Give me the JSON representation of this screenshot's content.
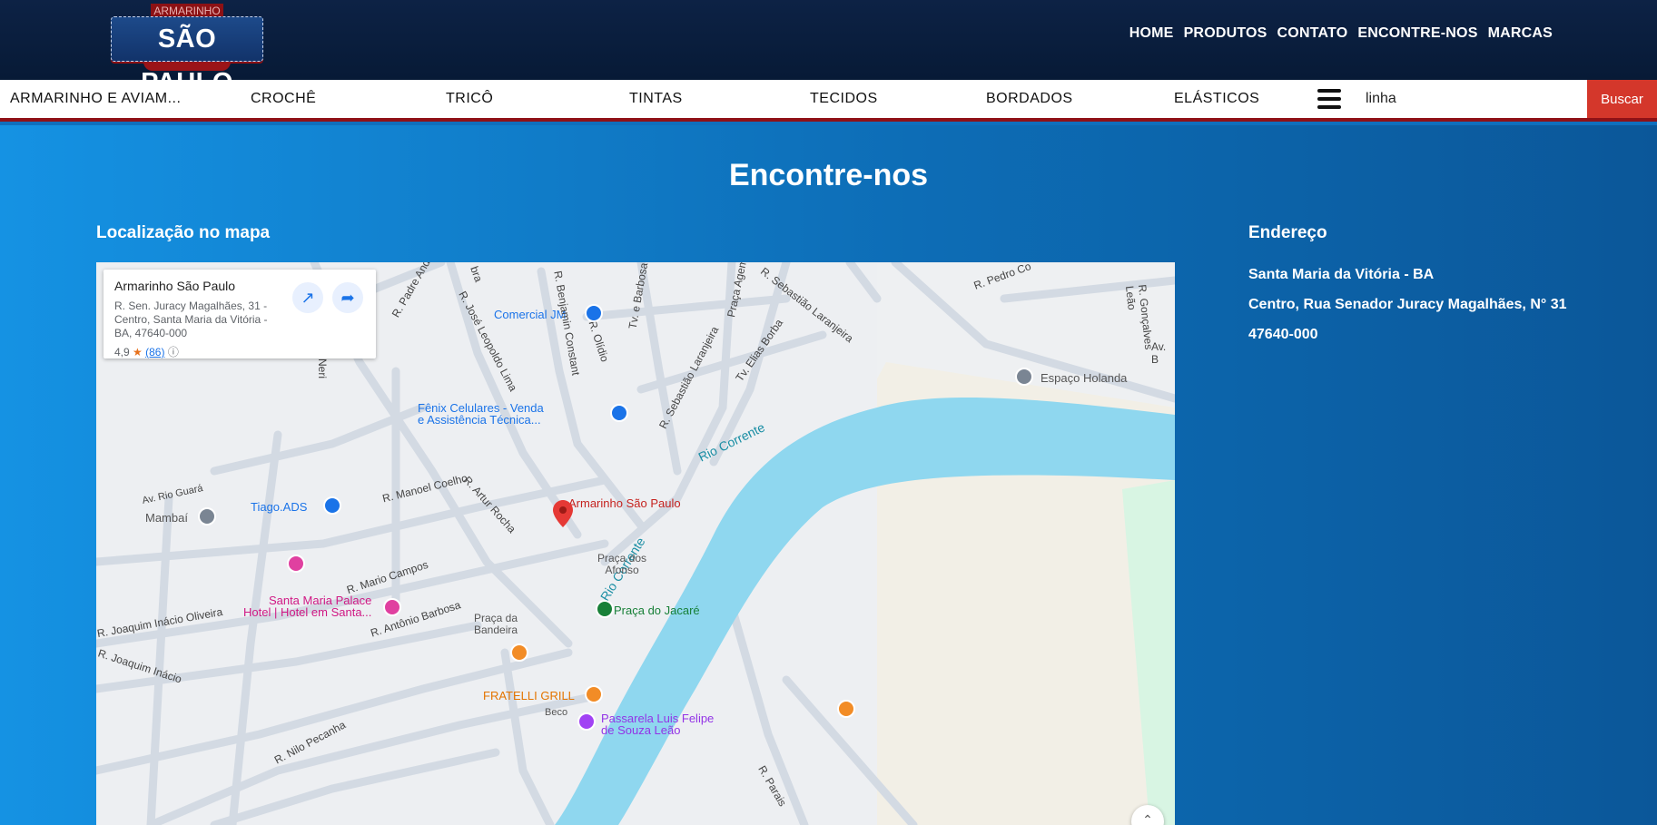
{
  "header": {
    "logo": {
      "top_text": "ARMARINHO",
      "main_text": "SÃO PAULO"
    },
    "nav": [
      {
        "label": "HOME"
      },
      {
        "label": "PRODUTOS"
      },
      {
        "label": "CONTATO"
      },
      {
        "label": "ENCONTRE-NOS"
      },
      {
        "label": "MARCAS"
      }
    ]
  },
  "categories": [
    {
      "label": "ARMARINHO E AVIAM..."
    },
    {
      "label": "CROCHÊ"
    },
    {
      "label": "TRICÔ"
    },
    {
      "label": "TINTAS"
    },
    {
      "label": "TECIDOS"
    },
    {
      "label": "BORDADOS"
    },
    {
      "label": "ELÁSTICOS"
    }
  ],
  "search": {
    "value": "linha",
    "button_label": "Buscar"
  },
  "page": {
    "title": "Encontre-nos",
    "map_section_title": "Localização no mapa",
    "address_section_title": "Endereço",
    "address_lines": [
      "Santa Maria da Vitória - BA",
      "Centro, Rua Senador Juracy Magalhães, N° 31",
      "47640-000"
    ]
  },
  "map": {
    "card": {
      "name": "Armarinho São Paulo",
      "address": "R. Sen. Juracy Magalhães, 31 - Centro, Santa Maria da Vitória - BA, 47640-000",
      "rating": "4,9",
      "star": "★",
      "reviews": "(86)",
      "info_icon": "ⓘ",
      "open_icon": "↗",
      "directions_icon": "➦"
    },
    "labels": {
      "place": "Armarinho São Paulo",
      "river1": "Rio Corrente",
      "river2": "Rio Corrente",
      "comercial": "Comercial JM",
      "fenix1": "Fênix Celulares - Venda",
      "fenix2": "e Assistência Técnica...",
      "tiago": "Tiago.ADS",
      "mambai": "Mambaí",
      "espaco": "Espaço Holanda",
      "pracaAfonso1": "Praça dos",
      "pracaAfonso2": "Afonso",
      "pracaJacare": "Praça do Jacaré",
      "pracaBandeira1": "Praça da",
      "pracaBandeira2": "Bandeira",
      "fratelli": "FRATELLI GRILL",
      "passarela1": "Passarela Luis Felipe",
      "passarela2": "de Souza Leão",
      "hotel1": "Santa Maria Palace",
      "hotel2": "Hotel | Hotel em Santa...",
      "beco": "Beco",
      "rPadre": "R. Padre Andr",
      "rJose": "R. José Leopoldo Lima",
      "rBenjamin": "R. Benjamin Constant",
      "rOlidio": "R. Olídio",
      "tvBarbosa": "Tv. e Barbosa",
      "tvElias": "Tv. Elias Borba",
      "rSebastiao1": "R. Sebastião Laranjeira",
      "rSebastiao2": "R. Sebastião Laranjeira",
      "pracaAgemi": "Praça Agemi",
      "rPedro": "R. Pedro Co",
      "rGoncalves": "R. Gonçalves Leão",
      "avFragment": "Av. B",
      "rManoel": "R. Manoel Coelho",
      "rArtur": "R. Artur Rocha",
      "rMario": "R. Mario Campos",
      "rAntonio": "R. Antônio Barbosa",
      "rJoaquim1": "R. Joaquim Inácio Oliveira",
      "rJoaquim2": "R. Joaquim Inácio",
      "rNilo": "R. Nilo Pecanha",
      "avRioGuara": "Av. Rio Guará",
      "rParais": "R. Parais",
      "neri": "Neri",
      "bra": "bra",
      "zoom": "⌃"
    }
  }
}
